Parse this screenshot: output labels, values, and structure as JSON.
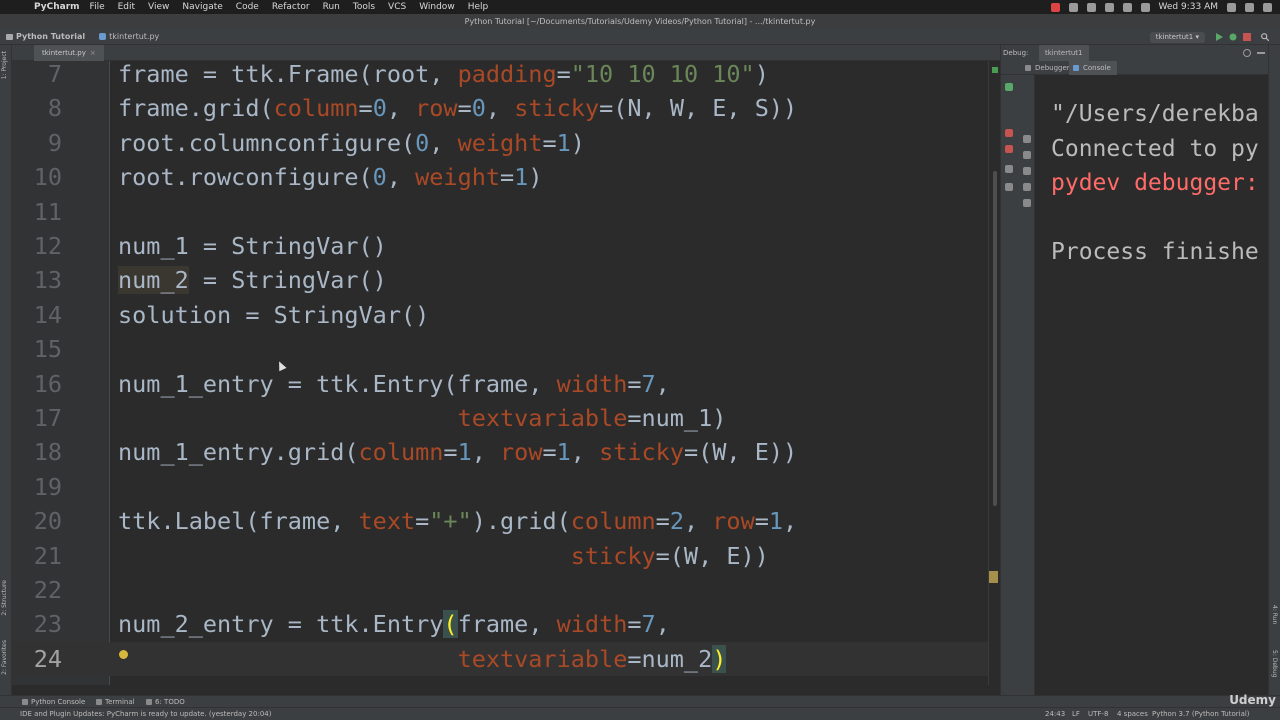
{
  "menubar": {
    "app_name": "PyCharm",
    "items": [
      "File",
      "Edit",
      "View",
      "Navigate",
      "Code",
      "Refactor",
      "Run",
      "Tools",
      "VCS",
      "Window",
      "Help"
    ],
    "clock": "Wed 9:33 AM"
  },
  "window": {
    "title": "Python Tutorial [~/Documents/Tutorials/Udemy Videos/Python Tutorial] - .../tkintertut.py"
  },
  "navbar": {
    "project": "Python Tutorial",
    "file": "tkintertut.py",
    "run_config": "tkintertut1"
  },
  "editor": {
    "tab_label": "tkintertut.py",
    "current_line": 24,
    "lines": [
      {
        "n": "7",
        "spans": [
          [
            "t",
            "frame = ttk.Frame(root, "
          ],
          [
            "kw",
            "padding"
          ],
          [
            "t",
            "="
          ],
          [
            "str",
            "\"10 10 10 10\""
          ],
          [
            "t",
            ")"
          ]
        ]
      },
      {
        "n": "8",
        "spans": [
          [
            "t",
            "frame.grid("
          ],
          [
            "kw",
            "column"
          ],
          [
            "t",
            "="
          ],
          [
            "num",
            "0"
          ],
          [
            "t",
            ", "
          ],
          [
            "kw",
            "row"
          ],
          [
            "t",
            "="
          ],
          [
            "num",
            "0"
          ],
          [
            "t",
            ", "
          ],
          [
            "kw",
            "sticky"
          ],
          [
            "t",
            "=(N, W, E, S))"
          ]
        ]
      },
      {
        "n": "9",
        "spans": [
          [
            "t",
            "root.columnconfigure("
          ],
          [
            "num",
            "0"
          ],
          [
            "t",
            ", "
          ],
          [
            "kw",
            "weight"
          ],
          [
            "t",
            "="
          ],
          [
            "num",
            "1"
          ],
          [
            "t",
            ")"
          ]
        ]
      },
      {
        "n": "10",
        "spans": [
          [
            "t",
            "root.rowconfigure("
          ],
          [
            "num",
            "0"
          ],
          [
            "t",
            ", "
          ],
          [
            "kw",
            "weight"
          ],
          [
            "t",
            "="
          ],
          [
            "num",
            "1"
          ],
          [
            "t",
            ")"
          ]
        ]
      },
      {
        "n": "11",
        "spans": []
      },
      {
        "n": "12",
        "spans": [
          [
            "t",
            "num_1 = StringVar()"
          ]
        ]
      },
      {
        "n": "13",
        "spans": [
          [
            "warn",
            "num_2"
          ],
          [
            "t",
            " = StringVar()"
          ]
        ]
      },
      {
        "n": "14",
        "spans": [
          [
            "t",
            "solution = StringVar()"
          ]
        ]
      },
      {
        "n": "15",
        "spans": []
      },
      {
        "n": "16",
        "spans": [
          [
            "t",
            "num_1_entry = ttk.Entry(frame, "
          ],
          [
            "kw",
            "width"
          ],
          [
            "t",
            "="
          ],
          [
            "num",
            "7"
          ],
          [
            "t",
            ","
          ]
        ]
      },
      {
        "n": "17",
        "spans": [
          [
            "t",
            "                        "
          ],
          [
            "kw",
            "textvariable"
          ],
          [
            "t",
            "=num_1)"
          ]
        ]
      },
      {
        "n": "18",
        "spans": [
          [
            "t",
            "num_1_entry.grid("
          ],
          [
            "kw",
            "column"
          ],
          [
            "t",
            "="
          ],
          [
            "num",
            "1"
          ],
          [
            "t",
            ", "
          ],
          [
            "kw",
            "row"
          ],
          [
            "t",
            "="
          ],
          [
            "num",
            "1"
          ],
          [
            "t",
            ", "
          ],
          [
            "kw",
            "sticky"
          ],
          [
            "t",
            "=(W, E))"
          ]
        ]
      },
      {
        "n": "19",
        "spans": []
      },
      {
        "n": "20",
        "spans": [
          [
            "t",
            "ttk.Label(frame, "
          ],
          [
            "kw",
            "text"
          ],
          [
            "t",
            "="
          ],
          [
            "str",
            "\"+\""
          ],
          [
            "t",
            ").grid("
          ],
          [
            "kw",
            "column"
          ],
          [
            "t",
            "="
          ],
          [
            "num",
            "2"
          ],
          [
            "t",
            ", "
          ],
          [
            "kw",
            "row"
          ],
          [
            "t",
            "="
          ],
          [
            "num",
            "1"
          ],
          [
            "t",
            ","
          ]
        ]
      },
      {
        "n": "21",
        "spans": [
          [
            "t",
            "                                "
          ],
          [
            "kw",
            "sticky"
          ],
          [
            "t",
            "=(W, E))"
          ]
        ]
      },
      {
        "n": "22",
        "spans": []
      },
      {
        "n": "23",
        "spans": [
          [
            "t",
            "num_2_entry = ttk.Entry"
          ],
          [
            "matched",
            "("
          ],
          [
            "t",
            "frame, "
          ],
          [
            "kw",
            "width"
          ],
          [
            "t",
            "="
          ],
          [
            "num",
            "7"
          ],
          [
            "t",
            ","
          ]
        ]
      },
      {
        "n": "24",
        "spans": [
          [
            "t",
            "                        "
          ],
          [
            "kw",
            "textvariable"
          ],
          [
            "t",
            "=num_2"
          ],
          [
            "matched",
            ")"
          ]
        ]
      }
    ]
  },
  "debugger": {
    "label": "Debug:",
    "tab": "tkintertut1",
    "tabs": [
      "Debugger",
      "Console"
    ],
    "console_lines": [
      {
        "text": "\"/Users/derekba",
        "kind": "normal"
      },
      {
        "text": "Connected to py",
        "kind": "normal"
      },
      {
        "text": "pydev debugger:",
        "kind": "err"
      },
      {
        "text": "",
        "kind": "normal"
      },
      {
        "text": "Process finishe",
        "kind": "normal"
      }
    ]
  },
  "left_strip": {
    "project": "1: Project",
    "structure": "2: Structure",
    "favorites": "2: Favorites"
  },
  "right_strip": {
    "run": "4: Run",
    "debug": "5: Debug"
  },
  "tool_windows": {
    "python_console": "Python Console",
    "terminal": "Terminal",
    "todo": "6: TODO"
  },
  "status": {
    "message": "IDE and Plugin Updates: PyCharm is ready to update. (yesterday 20:04)",
    "position": "24:43",
    "line_sep": "LF",
    "encoding": "UTF-8",
    "indent": "4 spaces",
    "interpreter": "Python 3.7 (Python Tutorial)",
    "watermark": "Udemy"
  },
  "colors": {
    "editor_bg": "#2b2b2b",
    "keyword_param": "#aa4926",
    "string": "#6a8759",
    "number": "#6897bb",
    "text": "#a9b7c6",
    "error": "#ff6b68"
  }
}
